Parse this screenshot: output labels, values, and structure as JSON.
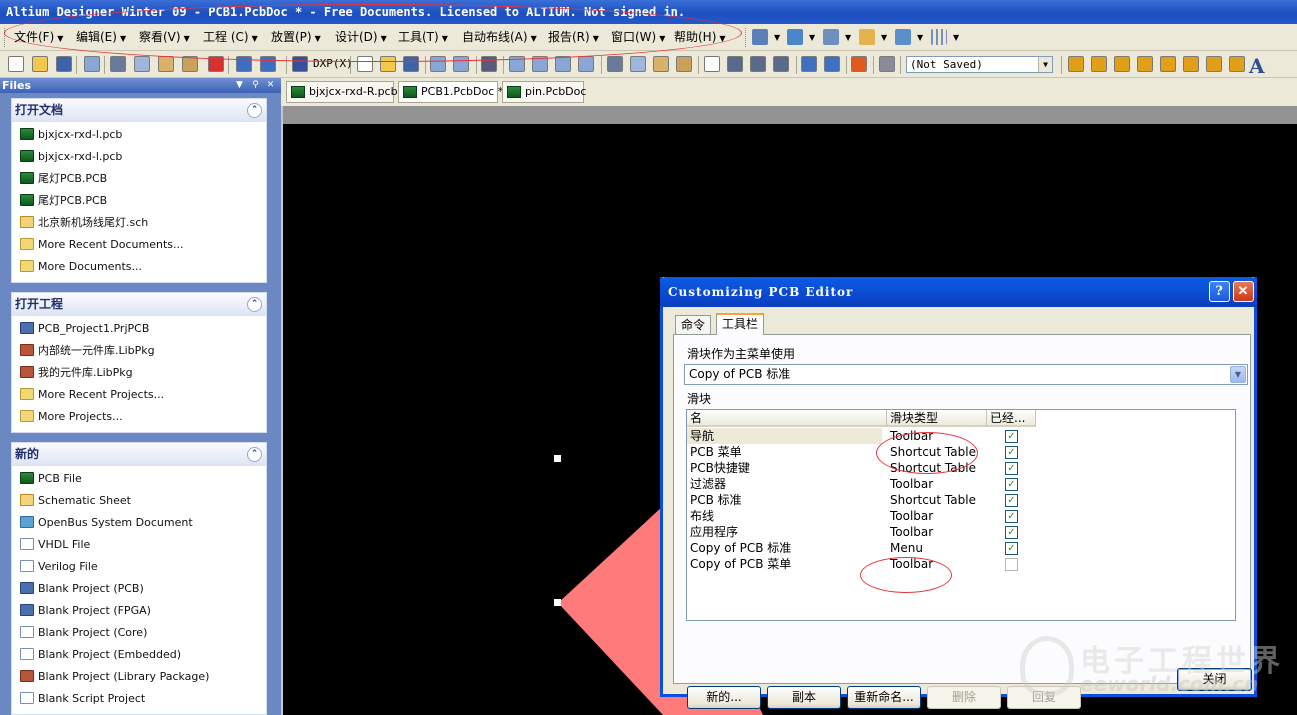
{
  "window": {
    "title": "Altium Designer Winter 09 - PCB1.PcbDoc * - Free Documents. Licensed to ALTIUM. Not signed in."
  },
  "menu": {
    "items": [
      "文件(F)",
      "编辑(E)",
      "察看(V)",
      "工程 (C)",
      "放置(P)",
      "设计(D)",
      "工具(T)",
      "自动布线(A)",
      "报告(R)",
      "窗口(W)",
      "帮助(H)"
    ]
  },
  "toolbar": {
    "dxp_label": "DXP(X)",
    "status_select": "(Not Saved)"
  },
  "files_panel": {
    "title": "Files",
    "sections": [
      {
        "title": "打开文档",
        "items": [
          {
            "label": "bjxjcx-rxd-l.pcb",
            "icon": "pcb-icon"
          },
          {
            "label": "bjxjcx-rxd-l.pcb",
            "icon": "pcb-icon"
          },
          {
            "label": "尾灯PCB.PCB",
            "icon": "pcb-icon"
          },
          {
            "label": "尾灯PCB.PCB",
            "icon": "pcb-icon"
          },
          {
            "label": "北京新机场线尾灯.sch",
            "icon": "schematic-icon"
          },
          {
            "label": "More Recent Documents...",
            "icon": "folder-icon"
          },
          {
            "label": "More Documents...",
            "icon": "folder-open-icon"
          }
        ]
      },
      {
        "title": "打开工程",
        "items": [
          {
            "label": "PCB_Project1.PrjPCB",
            "icon": "project-icon"
          },
          {
            "label": "内部统一元件库.LibPkg",
            "icon": "library-package-icon"
          },
          {
            "label": "我的元件库.LibPkg",
            "icon": "library-package-icon"
          },
          {
            "label": "More Recent Projects...",
            "icon": "folder-icon"
          },
          {
            "label": "More Projects...",
            "icon": "folder-open-icon"
          }
        ]
      },
      {
        "title": "新的",
        "items": [
          {
            "label": "PCB File",
            "icon": "pcb-icon"
          },
          {
            "label": "Schematic Sheet",
            "icon": "schematic-icon"
          },
          {
            "label": "OpenBus System Document",
            "icon": "openbus-icon"
          },
          {
            "label": "VHDL File",
            "icon": "vhdl-icon"
          },
          {
            "label": "Verilog File",
            "icon": "verilog-icon"
          },
          {
            "label": "Blank Project (PCB)",
            "icon": "project-icon"
          },
          {
            "label": "Blank Project (FPGA)",
            "icon": "project-icon"
          },
          {
            "label": "Blank Project (Core)",
            "icon": "document-icon"
          },
          {
            "label": "Blank Project (Embedded)",
            "icon": "document-icon"
          },
          {
            "label": "Blank Project (Library Package)",
            "icon": "library-package-icon"
          },
          {
            "label": "Blank Script Project",
            "icon": "document-icon"
          }
        ]
      }
    ]
  },
  "doc_tabs": [
    {
      "label": "bjxjcx-rxd-R.pcb"
    },
    {
      "label": "PCB1.PcbDoc *"
    },
    {
      "label": "pin.PcbDoc"
    }
  ],
  "dialog": {
    "title": "Customizing PCB Editor",
    "tabs": [
      "命令",
      "工具栏"
    ],
    "combo_label": "滑块作为主菜单使用",
    "combo_value": "Copy of PCB 标准",
    "list_label": "滑块",
    "columns": [
      "名",
      "滑块类型",
      "已经..."
    ],
    "rows": [
      {
        "name": "导航",
        "type": "Toolbar",
        "checked": true
      },
      {
        "name": "PCB 菜单",
        "type": "Shortcut Table",
        "checked": true
      },
      {
        "name": "PCB快捷键",
        "type": "Shortcut Table",
        "checked": true
      },
      {
        "name": "过滤器",
        "type": "Toolbar",
        "checked": true
      },
      {
        "name": "PCB 标准",
        "type": "Shortcut Table",
        "checked": true
      },
      {
        "name": "布线",
        "type": "Toolbar",
        "checked": true
      },
      {
        "name": "应用程序",
        "type": "Toolbar",
        "checked": true
      },
      {
        "name": "Copy of PCB 标准",
        "type": "Menu",
        "checked": true
      },
      {
        "name": "Copy of PCB 菜单",
        "type": "Toolbar",
        "checked": false
      }
    ],
    "buttons": {
      "new": "新的...",
      "copy": "副本",
      "rename": "重新命名...",
      "delete": "删除",
      "restore": "回复",
      "close": "关闭"
    }
  },
  "watermark": {
    "text_cn": "电子工程世界",
    "text_en": "eeworld.com.cn"
  },
  "colors": {
    "title_bar": "#1c4fc0",
    "annotation": "#e8333a",
    "pcb_shape": "#ff7a7a"
  }
}
